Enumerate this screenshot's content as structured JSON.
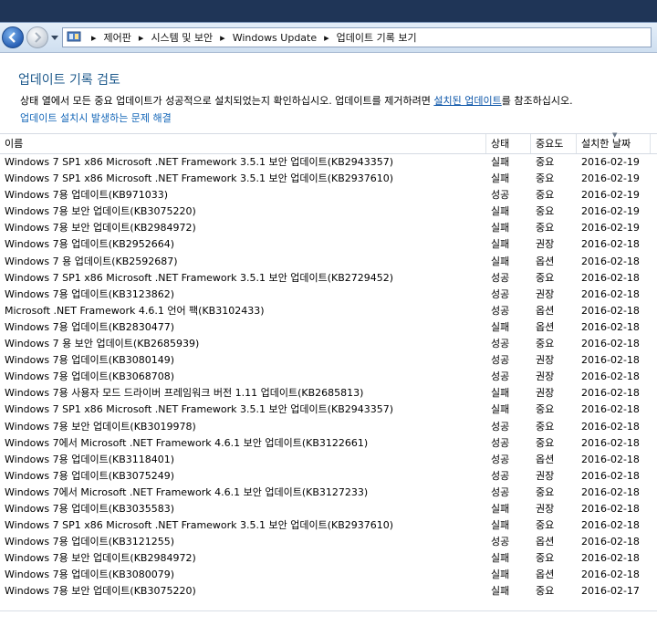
{
  "breadcrumb": {
    "items": [
      "제어판",
      "시스템 및 보안",
      "Windows Update",
      "업데이트 기록 보기"
    ]
  },
  "page": {
    "title": "업데이트 기록 검토",
    "description_before": "상태 열에서 모든 중요 업데이트가 성공적으로 설치되었는지 확인하십시오. 업데이트를 제거하려면 ",
    "description_link": "설치된 업데이트",
    "description_after": "를 참조하십시오.",
    "help_link": "업데이트 설치시 발생하는 문제 해결"
  },
  "columns": {
    "name": "이름",
    "status": "상태",
    "importance": "중요도",
    "date": "설치한 날짜"
  },
  "updates": [
    {
      "name": "Windows 7 SP1 x86 Microsoft .NET Framework 3.5.1 보안 업데이트(KB2943357)",
      "status": "실패",
      "importance": "중요",
      "date": "2016-02-19"
    },
    {
      "name": "Windows 7 SP1 x86 Microsoft .NET Framework 3.5.1 보안 업데이트(KB2937610)",
      "status": "실패",
      "importance": "중요",
      "date": "2016-02-19"
    },
    {
      "name": "Windows 7용 업데이트(KB971033)",
      "status": "성공",
      "importance": "중요",
      "date": "2016-02-19"
    },
    {
      "name": "Windows 7용 보안 업데이트(KB3075220)",
      "status": "실패",
      "importance": "중요",
      "date": "2016-02-19"
    },
    {
      "name": "Windows 7용 보안 업데이트(KB2984972)",
      "status": "실패",
      "importance": "중요",
      "date": "2016-02-19"
    },
    {
      "name": "Windows 7용 업데이트(KB2952664)",
      "status": "실패",
      "importance": "권장",
      "date": "2016-02-18"
    },
    {
      "name": "Windows 7 용 업데이트(KB2592687)",
      "status": "실패",
      "importance": "옵션",
      "date": "2016-02-18"
    },
    {
      "name": "Windows 7 SP1 x86 Microsoft .NET Framework 3.5.1 보안 업데이트(KB2729452)",
      "status": "성공",
      "importance": "중요",
      "date": "2016-02-18"
    },
    {
      "name": "Windows 7용 업데이트(KB3123862)",
      "status": "성공",
      "importance": "권장",
      "date": "2016-02-18"
    },
    {
      "name": "Microsoft .NET Framework 4.6.1 언어 팩(KB3102433)",
      "status": "성공",
      "importance": "옵션",
      "date": "2016-02-18"
    },
    {
      "name": "Windows 7용 업데이트(KB2830477)",
      "status": "실패",
      "importance": "옵션",
      "date": "2016-02-18"
    },
    {
      "name": "Windows 7 용 보안 업데이트(KB2685939)",
      "status": "성공",
      "importance": "중요",
      "date": "2016-02-18"
    },
    {
      "name": "Windows 7용 업데이트(KB3080149)",
      "status": "성공",
      "importance": "권장",
      "date": "2016-02-18"
    },
    {
      "name": "Windows 7용 업데이트(KB3068708)",
      "status": "성공",
      "importance": "권장",
      "date": "2016-02-18"
    },
    {
      "name": "Windows 7용 사용자 모드 드라이버 프레임워크 버전 1.11 업데이트(KB2685813)",
      "status": "실패",
      "importance": "권장",
      "date": "2016-02-18"
    },
    {
      "name": "Windows 7 SP1 x86 Microsoft .NET Framework 3.5.1 보안 업데이트(KB2943357)",
      "status": "실패",
      "importance": "중요",
      "date": "2016-02-18"
    },
    {
      "name": "Windows 7용 보안 업데이트(KB3019978)",
      "status": "성공",
      "importance": "중요",
      "date": "2016-02-18"
    },
    {
      "name": "Windows 7에서 Microsoft .NET Framework 4.6.1 보안 업데이트(KB3122661)",
      "status": "성공",
      "importance": "중요",
      "date": "2016-02-18"
    },
    {
      "name": "Windows 7용 업데이트(KB3118401)",
      "status": "성공",
      "importance": "옵션",
      "date": "2016-02-18"
    },
    {
      "name": "Windows 7용 업데이트(KB3075249)",
      "status": "성공",
      "importance": "권장",
      "date": "2016-02-18"
    },
    {
      "name": "Windows 7에서 Microsoft .NET Framework 4.6.1 보안 업데이트(KB3127233)",
      "status": "성공",
      "importance": "중요",
      "date": "2016-02-18"
    },
    {
      "name": "Windows 7용 업데이트(KB3035583)",
      "status": "실패",
      "importance": "권장",
      "date": "2016-02-18"
    },
    {
      "name": "Windows 7 SP1 x86 Microsoft .NET Framework 3.5.1 보안 업데이트(KB2937610)",
      "status": "실패",
      "importance": "중요",
      "date": "2016-02-18"
    },
    {
      "name": "Windows 7용 업데이트(KB3121255)",
      "status": "성공",
      "importance": "옵션",
      "date": "2016-02-18"
    },
    {
      "name": "Windows 7용 보안 업데이트(KB2984972)",
      "status": "실패",
      "importance": "중요",
      "date": "2016-02-18"
    },
    {
      "name": "Windows 7용 업데이트(KB3080079)",
      "status": "실패",
      "importance": "옵션",
      "date": "2016-02-18"
    },
    {
      "name": "Windows 7용 보안 업데이트(KB3075220)",
      "status": "실패",
      "importance": "중요",
      "date": "2016-02-17"
    }
  ]
}
